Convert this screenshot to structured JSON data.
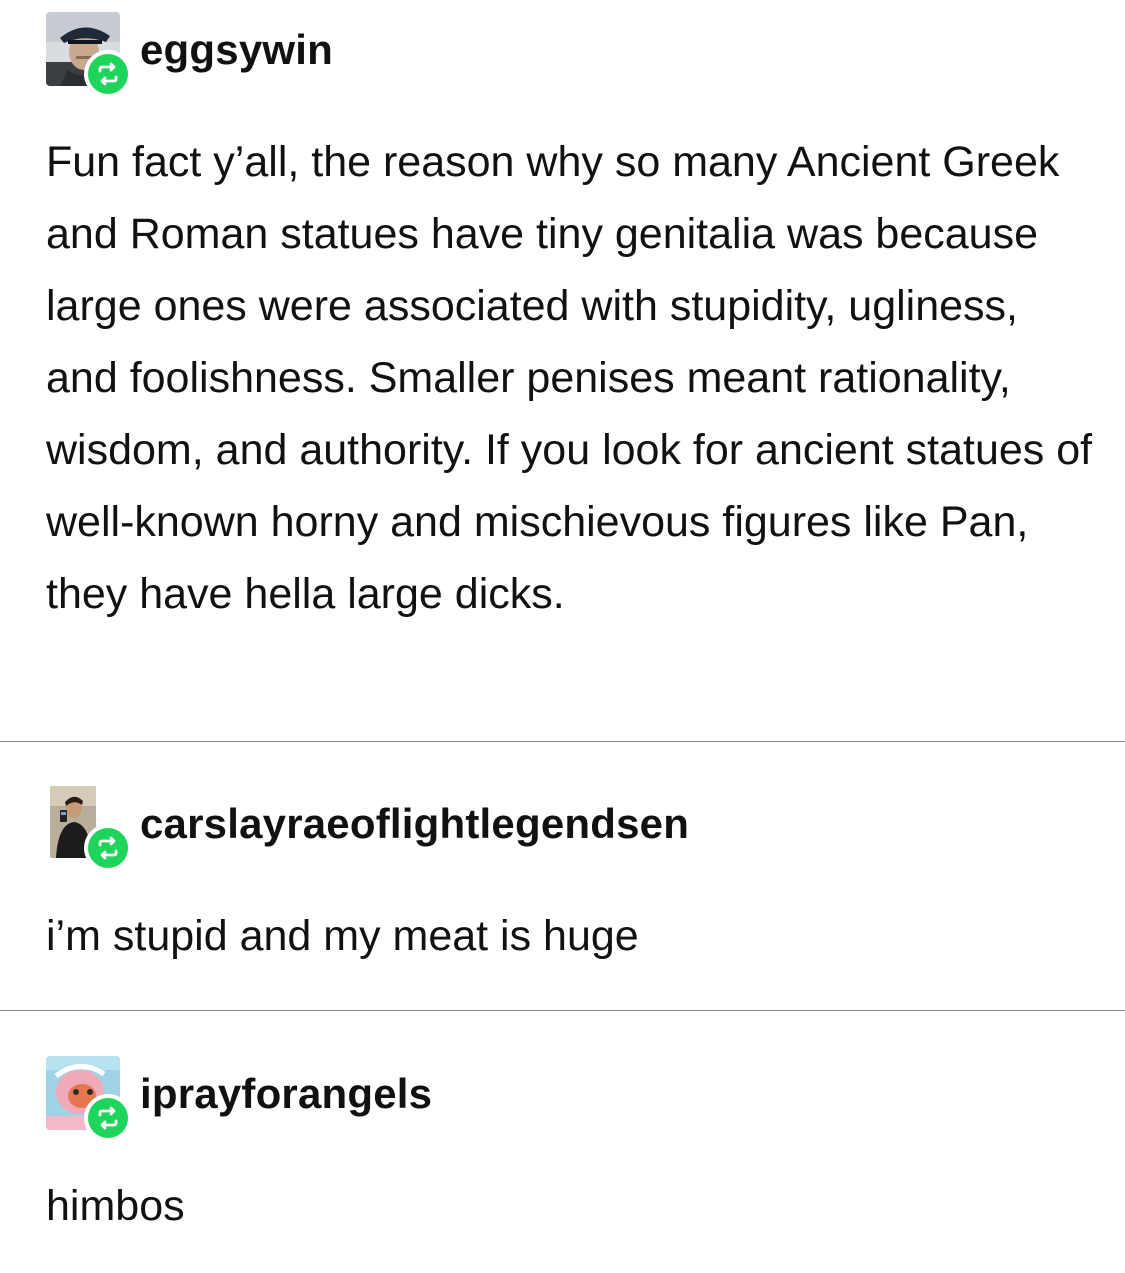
{
  "posts": [
    {
      "username": "eggsywin",
      "avatar_icon": "man-in-cap-avatar",
      "reblog_icon": "reblog-icon",
      "text": "Fun fact y’all, the reason why so many Ancient Greek and Roman statues have tiny genitalia was because large ones were associated with stupidity, ugliness, and foolishness. Smaller penises meant rationality, wisdom, and authority. If you look for ancient statues of well-known horny and mischievous figures like Pan, they have hella large dicks."
    },
    {
      "username": "carslayraeoflightlegendsen",
      "avatar_icon": "mirror-selfie-avatar",
      "reblog_icon": "reblog-icon",
      "text": "i’m stupid and my meat is huge"
    },
    {
      "username": "iprayforangels",
      "avatar_icon": "cartoon-character-avatar",
      "reblog_icon": "reblog-icon",
      "text": "himbos"
    }
  ],
  "colors": {
    "reblog_green": "#1fd45a",
    "text": "#111111",
    "divider": "#8a8a8a"
  }
}
